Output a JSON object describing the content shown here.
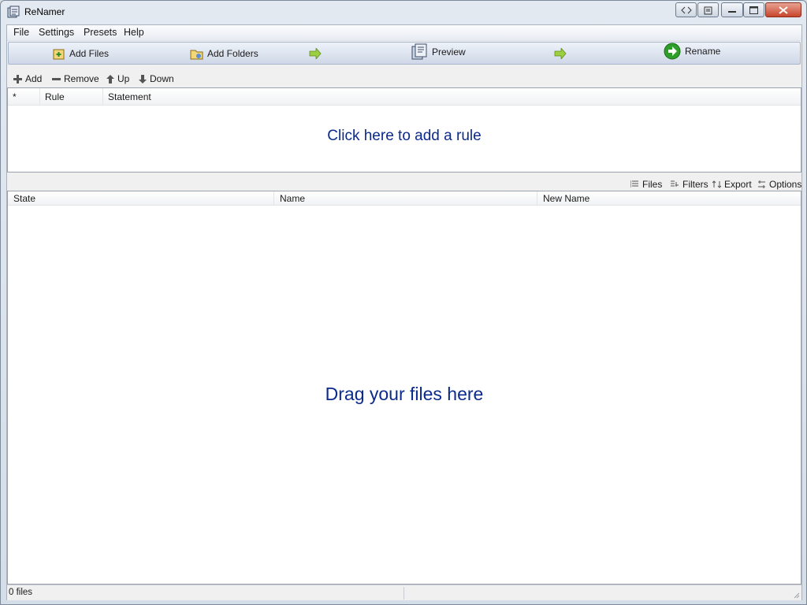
{
  "window": {
    "title": "ReNamer"
  },
  "menu": {
    "items": [
      "File",
      "Settings",
      "Presets",
      "Help"
    ]
  },
  "actions": {
    "add_files": "Add Files",
    "add_folders": "Add Folders",
    "preview": "Preview",
    "rename": "Rename"
  },
  "rule_toolbar": {
    "add": "Add",
    "remove": "Remove",
    "up": "Up",
    "down": "Down"
  },
  "rules_table": {
    "columns": [
      "*",
      "Rule",
      "Statement"
    ],
    "empty_message": "Click here to add a rule"
  },
  "files_toolbar": {
    "files": "Files",
    "filters": "Filters",
    "export": "Export",
    "options": "Options"
  },
  "files_table": {
    "columns": [
      "State",
      "Name",
      "New Name"
    ],
    "empty_message": "Drag your files here"
  },
  "status": {
    "file_count": "0 files"
  },
  "colors": {
    "accent_text": "#0a2a8c",
    "toolbar_bg": "#dfe6f2",
    "rename_green": "#2e9e2a"
  }
}
